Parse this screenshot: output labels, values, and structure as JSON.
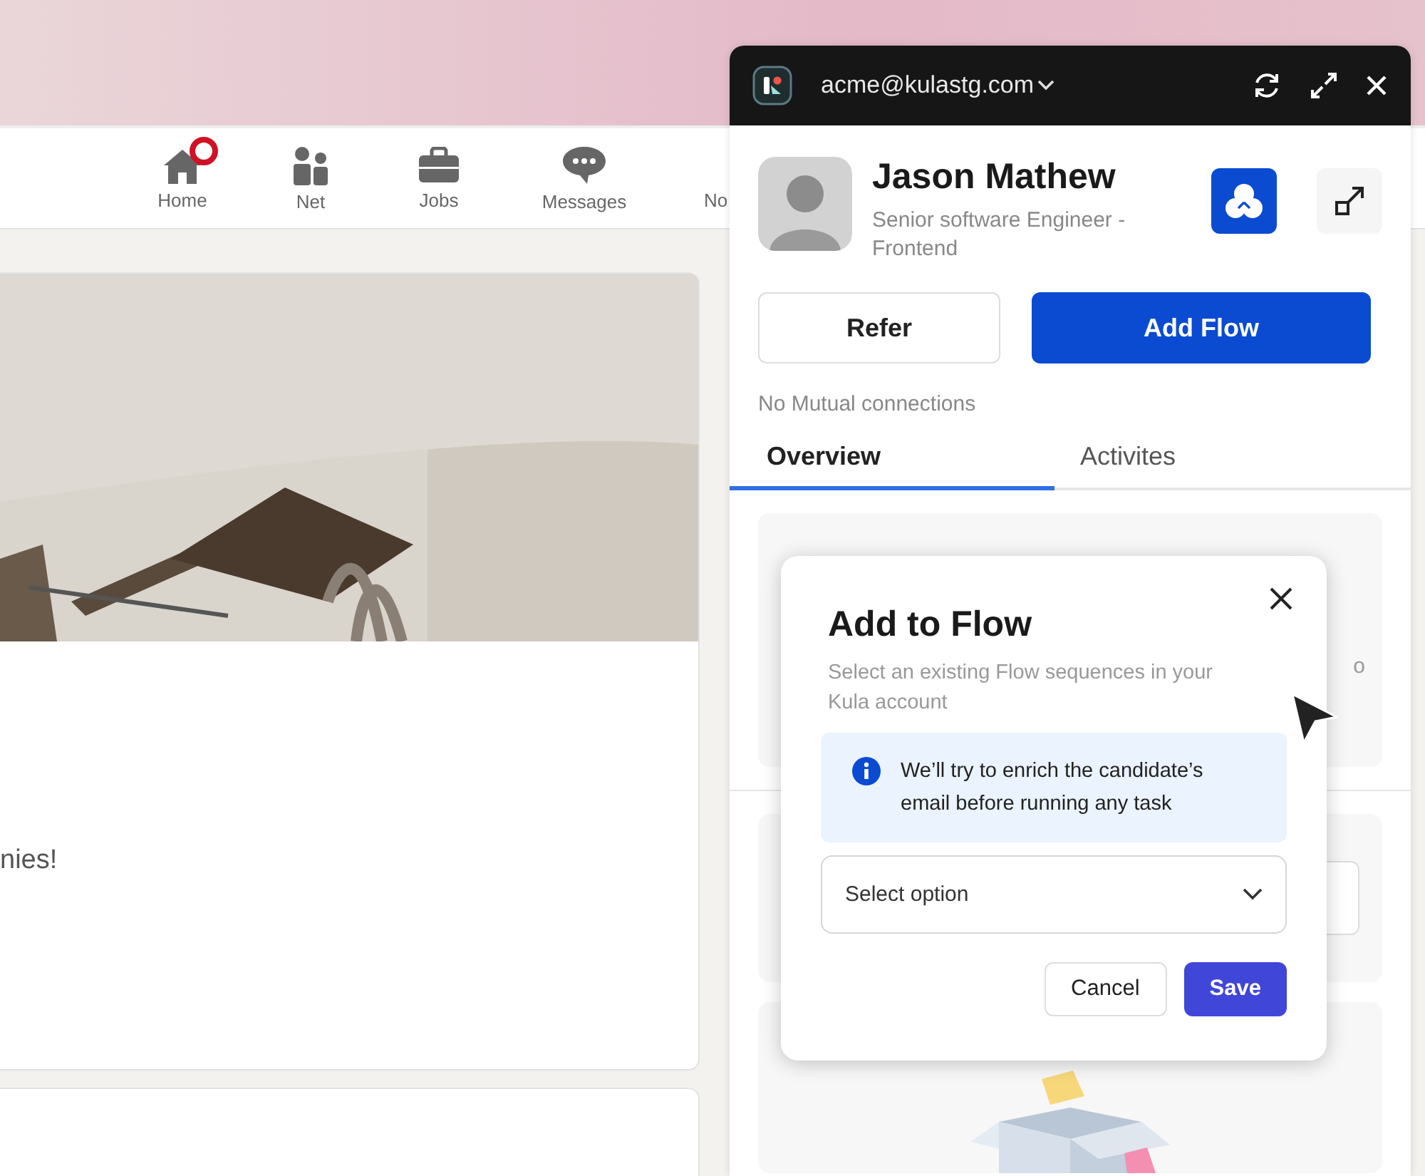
{
  "nav": {
    "items": [
      {
        "label": "Home",
        "badge": true
      },
      {
        "label": "Net",
        "badge": false
      },
      {
        "label": "Jobs",
        "badge": false
      },
      {
        "label": "Messages",
        "badge": false
      },
      {
        "label": "No",
        "badge": false
      }
    ]
  },
  "feed": {
    "post_text": "nies!"
  },
  "extension": {
    "account": "acme@kulastg.com",
    "profile": {
      "name": "Jason Mathew",
      "title": "Senior software Engineer - Frontend"
    },
    "buttons": [
      {
        "label": "Refer",
        "kind": "secondary"
      },
      {
        "label": "Add Flow",
        "kind": "primary"
      }
    ],
    "mutual": "No Mutual connections",
    "tabs": [
      {
        "label": "Overview",
        "selected": true
      },
      {
        "label": "Activites",
        "selected": false
      }
    ],
    "card_text": "o"
  },
  "dialog": {
    "title": "Add to Flow",
    "subtitle": "Select an existing Flow sequences in your Kula account",
    "info": "We’ll try to enrich the candidate’s email before running any task",
    "select": {
      "placeholder": "Select option"
    },
    "buttons": [
      {
        "label": "Cancel",
        "kind": "secondary"
      },
      {
        "label": "Save",
        "kind": "primary"
      }
    ]
  }
}
